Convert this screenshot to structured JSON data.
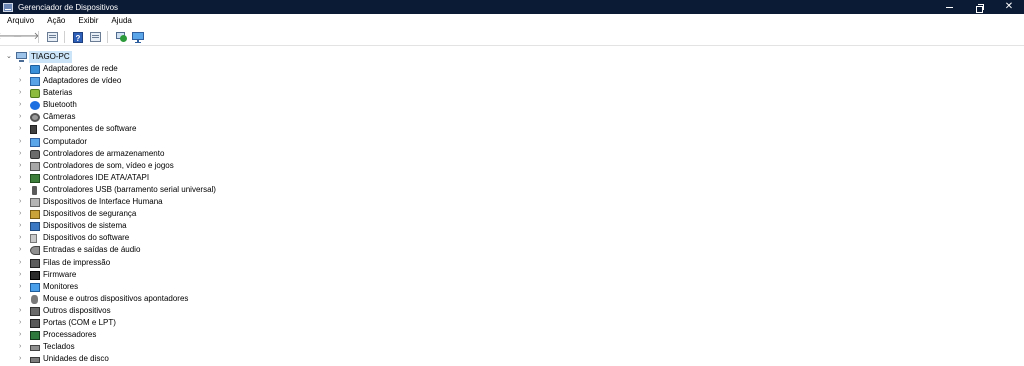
{
  "window": {
    "title": "Gerenciador de Dispositivos",
    "icon": "device-manager-icon",
    "buttons": {
      "minimize": "—",
      "restore": "restore-icon",
      "close": "✕"
    }
  },
  "menu": [
    "Arquivo",
    "Ação",
    "Exibir",
    "Ajuda"
  ],
  "toolbar": {
    "buttons": [
      "back-icon",
      "forward-icon",
      "properties-icon",
      "help-icon",
      "view-icon",
      "scan-hardware-icon",
      "monitor-icon"
    ],
    "back": "🡐",
    "forward": "🡒",
    "help": "?"
  },
  "tree": {
    "root": "TIAGO-PC",
    "expand_glyph": "›",
    "collapse_glyph": "⌄",
    "items": [
      {
        "label": "Adaptadores de rede",
        "icon": "network-adapter-icon"
      },
      {
        "label": "Adaptadores de vídeo",
        "icon": "display-adapter-icon"
      },
      {
        "label": "Baterias",
        "icon": "battery-icon"
      },
      {
        "label": "Bluetooth",
        "icon": "bluetooth-icon"
      },
      {
        "label": "Câmeras",
        "icon": "camera-icon"
      },
      {
        "label": "Componentes de software",
        "icon": "software-component-icon"
      },
      {
        "label": "Computador",
        "icon": "computer-icon"
      },
      {
        "label": "Controladores de armazenamento",
        "icon": "storage-controller-icon"
      },
      {
        "label": "Controladores de som, vídeo e jogos",
        "icon": "sound-controller-icon"
      },
      {
        "label": "Controladores IDE ATA/ATAPI",
        "icon": "ide-controller-icon"
      },
      {
        "label": "Controladores USB (barramento serial universal)",
        "icon": "usb-icon"
      },
      {
        "label": "Dispositivos de Interface Humana",
        "icon": "hid-icon"
      },
      {
        "label": "Dispositivos de segurança",
        "icon": "security-device-icon"
      },
      {
        "label": "Dispositivos de sistema",
        "icon": "system-device-icon"
      },
      {
        "label": "Dispositivos do software",
        "icon": "software-device-icon"
      },
      {
        "label": "Entradas e saídas de áudio",
        "icon": "audio-io-icon"
      },
      {
        "label": "Filas de impressão",
        "icon": "print-queue-icon"
      },
      {
        "label": "Firmware",
        "icon": "firmware-icon"
      },
      {
        "label": "Monitores",
        "icon": "monitor-icon"
      },
      {
        "label": "Mouse e outros dispositivos apontadores",
        "icon": "mouse-icon"
      },
      {
        "label": "Outros dispositivos",
        "icon": "other-device-icon"
      },
      {
        "label": "Portas (COM e LPT)",
        "icon": "port-icon"
      },
      {
        "label": "Processadores",
        "icon": "processor-icon"
      },
      {
        "label": "Teclados",
        "icon": "keyboard-icon"
      },
      {
        "label": "Unidades de disco",
        "icon": "disk-drive-icon"
      }
    ]
  }
}
